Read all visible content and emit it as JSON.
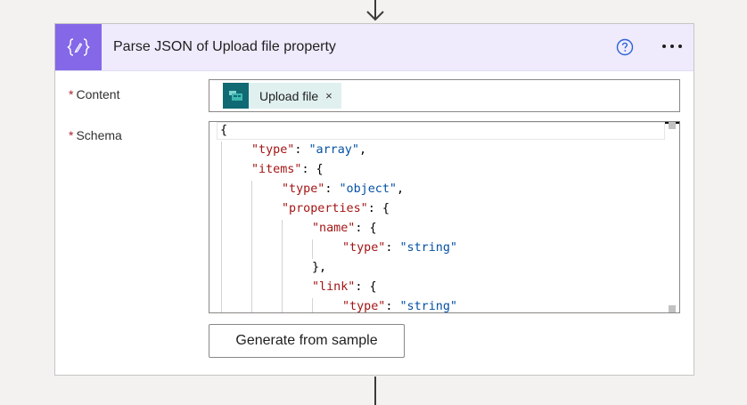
{
  "action": {
    "title": "Parse JSON of Upload file property",
    "icon": "braces-icon",
    "accent": "#8468e8",
    "header_bg": "#efebfd"
  },
  "fields": {
    "content": {
      "label": "Content",
      "required_mark": "*",
      "token": {
        "label": "Upload file",
        "close": "×",
        "icon": "form-app-icon"
      }
    },
    "schema": {
      "label": "Schema",
      "required_mark": "*",
      "lines": [
        [
          {
            "t": "p",
            "v": "{"
          }
        ],
        [
          {
            "t": "k",
            "v": "\"type\""
          },
          {
            "t": "p",
            "v": ": "
          },
          {
            "t": "s",
            "v": "\"array\""
          },
          {
            "t": "p",
            "v": ","
          }
        ],
        [
          {
            "t": "k",
            "v": "\"items\""
          },
          {
            "t": "p",
            "v": ": {"
          }
        ],
        [
          {
            "t": "k",
            "v": "\"type\""
          },
          {
            "t": "p",
            "v": ": "
          },
          {
            "t": "s",
            "v": "\"object\""
          },
          {
            "t": "p",
            "v": ","
          }
        ],
        [
          {
            "t": "k",
            "v": "\"properties\""
          },
          {
            "t": "p",
            "v": ": {"
          }
        ],
        [
          {
            "t": "k",
            "v": "\"name\""
          },
          {
            "t": "p",
            "v": ": {"
          }
        ],
        [
          {
            "t": "k",
            "v": "\"type\""
          },
          {
            "t": "p",
            "v": ": "
          },
          {
            "t": "s",
            "v": "\"string\""
          }
        ],
        [
          {
            "t": "p",
            "v": "},"
          }
        ],
        [
          {
            "t": "k",
            "v": "\"link\""
          },
          {
            "t": "p",
            "v": ": {"
          }
        ],
        [
          {
            "t": "k",
            "v": "\"type\""
          },
          {
            "t": "p",
            "v": ": "
          },
          {
            "t": "s",
            "v": "\"string\""
          }
        ]
      ]
    }
  },
  "buttons": {
    "generate": "Generate from sample"
  }
}
